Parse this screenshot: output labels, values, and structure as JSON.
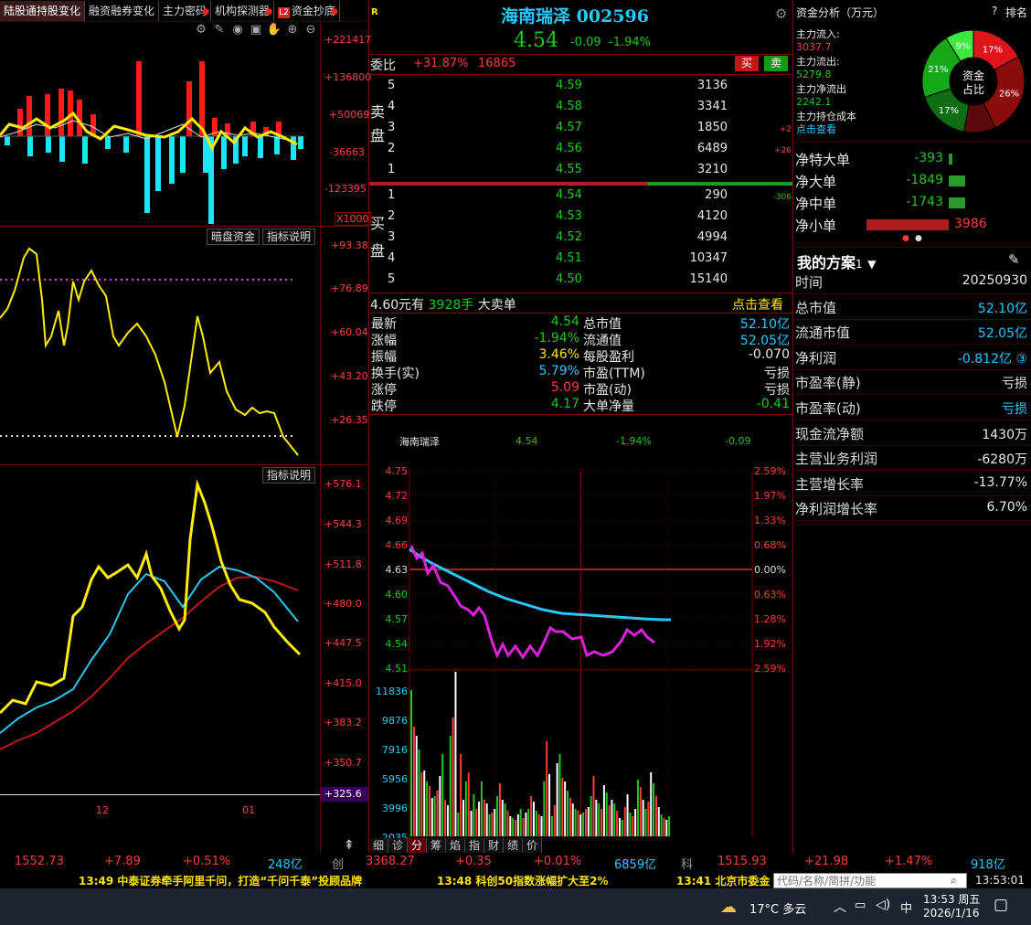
{
  "tabs": [
    {
      "label": "陆股通持股变化",
      "active": true,
      "dot": false
    },
    {
      "label": "融资融券变化",
      "active": false,
      "dot": false
    },
    {
      "label": "主力密码",
      "active": false,
      "dot": true
    },
    {
      "label": "机构探测器",
      "active": false,
      "dot": true
    },
    {
      "label": "资金抄底",
      "active": false,
      "dot": true,
      "badge": "L2"
    }
  ],
  "panel1": {
    "axis": [
      "+221417",
      "+136800",
      "+50069",
      "-36663",
      "-123395"
    ],
    "unit": "X1000"
  },
  "panel2": {
    "buttons": [
      "暗盘资金",
      "指标说明"
    ],
    "axis": [
      "+93.38",
      "+76.89",
      "+60.04",
      "+43.20",
      "+26.35"
    ]
  },
  "panel3": {
    "button": "指标说明",
    "axis": [
      "+576.1",
      "+544.3",
      "+511.8",
      "+480.0",
      "+447.5",
      "+415.0",
      "+383.2",
      "+350.7"
    ],
    "current": "+325.6",
    "xlabels": [
      "12",
      "01"
    ]
  },
  "header": {
    "r_badge": "R",
    "name": "海南瑞泽",
    "code": "002596",
    "price": "4.54",
    "change": "-0.09",
    "pct": "-1.94%"
  },
  "weibi": {
    "label": "委比",
    "pct": "+31.87%",
    "diff": "16865",
    "buy": "买",
    "sell": "卖"
  },
  "orderbook": {
    "sell_label": [
      "卖",
      "盘"
    ],
    "buy_label": [
      "买",
      "盘"
    ],
    "asks": [
      {
        "lvl": "5",
        "price": "4.59",
        "vol": "3136",
        "chg": ""
      },
      {
        "lvl": "4",
        "price": "4.58",
        "vol": "3341",
        "chg": ""
      },
      {
        "lvl": "3",
        "price": "4.57",
        "vol": "1850",
        "chg": "+2"
      },
      {
        "lvl": "2",
        "price": "4.56",
        "vol": "6489",
        "chg": "+26"
      },
      {
        "lvl": "1",
        "price": "4.55",
        "vol": "3210",
        "chg": ""
      }
    ],
    "bids": [
      {
        "lvl": "1",
        "price": "4.54",
        "vol": "290",
        "chg": "-306"
      },
      {
        "lvl": "2",
        "price": "4.53",
        "vol": "4120",
        "chg": ""
      },
      {
        "lvl": "3",
        "price": "4.52",
        "vol": "4994",
        "chg": ""
      },
      {
        "lvl": "4",
        "price": "4.51",
        "vol": "10347",
        "chg": ""
      },
      {
        "lvl": "5",
        "price": "4.50",
        "vol": "15140",
        "chg": ""
      }
    ]
  },
  "bigorder": {
    "price": "4.60元有",
    "vol": "3928手",
    "label": "大卖单",
    "link": "点击查看"
  },
  "stats": {
    "left": [
      {
        "k": "最新",
        "v": "4.54",
        "c": "grn"
      },
      {
        "k": "涨幅",
        "v": "-1.94%",
        "c": "grn"
      },
      {
        "k": "振幅",
        "v": "3.46%",
        "c": "yel"
      },
      {
        "k": "换手(实)",
        "v": "5.79%",
        "c": "cyn"
      },
      {
        "k": "涨停",
        "v": "5.09",
        "c": "red"
      },
      {
        "k": "跌停",
        "v": "4.17",
        "c": "grn"
      }
    ],
    "right": [
      {
        "k": "总市值",
        "v": "52.10亿",
        "c": "cyn"
      },
      {
        "k": "流通值",
        "v": "52.05亿",
        "c": "cyn"
      },
      {
        "k": "每股盈利",
        "v": "-0.070",
        "c": "wht"
      },
      {
        "k": "市盈(TTM)",
        "v": "亏损",
        "c": "wht"
      },
      {
        "k": "市盈(动)",
        "v": "亏损",
        "c": "wht"
      },
      {
        "k": "大单净量",
        "v": "-0.41",
        "c": "grn"
      }
    ]
  },
  "intraday": {
    "title": "海南瑞泽",
    "price": "4.54",
    "pct": "-1.94%",
    "chg": "-0.09",
    "yticks": [
      "4.75",
      "4.72",
      "4.69",
      "4.66",
      "4.63",
      "4.60",
      "4.57",
      "4.54",
      "4.51"
    ],
    "pticks": [
      "2.59%",
      "1.97%",
      "1.33%",
      "0.68%",
      "0.00%",
      "0.63%",
      "1.28%",
      "1.92%",
      "2.59%"
    ],
    "volticks": [
      "11836",
      "9876",
      "7916",
      "5956",
      "3996",
      "2035"
    ],
    "tabs": [
      "细",
      "诊",
      "分",
      "筹",
      "焰",
      "指",
      "财",
      "绩",
      "价"
    ],
    "active_tab": "分"
  },
  "capital": {
    "title": "资金分析（万元）",
    "help": "?",
    "rank": "排名",
    "inflow_label": "主力流入:",
    "inflow": "3037.7",
    "outflow_label": "主力流出:",
    "outflow": "5279.8",
    "net_label": "主力净流出",
    "net": "2242.1",
    "cost_label": "主力持仓成本",
    "cost_link": "点击查看",
    "donut_center": [
      "资金",
      "占比"
    ],
    "donut": [
      {
        "label": "17%",
        "value": 17,
        "color": "#e0151c"
      },
      {
        "label": "26%",
        "value": 26,
        "color": "#8a0d0d"
      },
      {
        "label": "",
        "value": 10,
        "color": "#5a0a0a"
      },
      {
        "label": "17%",
        "value": 17,
        "color": "#0f6e12"
      },
      {
        "label": "21%",
        "value": 21,
        "color": "#17a81a"
      },
      {
        "label": "9%",
        "value": 9,
        "color": "#3ee83e"
      }
    ]
  },
  "netflow": [
    {
      "label": "净特大单",
      "value": "-393",
      "c": "grn",
      "frac": 0.1
    },
    {
      "label": "净大单",
      "value": "-1849",
      "c": "grn",
      "frac": 0.46
    },
    {
      "label": "净中单",
      "value": "-1743",
      "c": "grn",
      "frac": 0.44
    },
    {
      "label": "净小单",
      "value": "3986",
      "c": "red",
      "frac": 1.0
    }
  ],
  "plan": {
    "title": "我的方案",
    "num": "1",
    "edit": "✎",
    "rows": [
      {
        "k": "时间",
        "v": "20250930",
        "c": "wht"
      },
      {
        "k": "总市值",
        "v": "52.10亿",
        "c": "cyn"
      },
      {
        "k": "流通市值",
        "v": "52.05亿",
        "c": "cyn"
      },
      {
        "k": "净利润",
        "v": "-0.812亿 ③",
        "c": "cyn"
      },
      {
        "k": "市盈率(静)",
        "v": "亏损",
        "c": "wht"
      },
      {
        "k": "市盈率(动)",
        "v": "亏损",
        "c": "cyn"
      },
      {
        "k": "现金流净额",
        "v": "1430万",
        "c": "wht"
      },
      {
        "k": "主营业务利润",
        "v": "-6280万",
        "c": "wht"
      },
      {
        "k": "主营增长率",
        "v": "-13.77%",
        "c": "wht"
      },
      {
        "k": "净利润增长率",
        "v": "6.70%",
        "c": "wht"
      }
    ]
  },
  "status": {
    "sh": {
      "val": "1552.73",
      "chg": "+7.89",
      "pct": "+0.51%",
      "amt": "248亿"
    },
    "cy": {
      "label": "创",
      "val": "3368.27",
      "chg": "+0.35",
      "pct": "+0.01%",
      "amt": "6859亿"
    },
    "kc": {
      "label": "科",
      "val": "1515.93",
      "chg": "+21.98",
      "pct": "+1.47%",
      "amt": "918亿"
    }
  },
  "news": [
    {
      "time": "13:49",
      "text": "中泰证券牵手阿里千问，打造“千问千泰”投顾品牌"
    },
    {
      "time": "13:48",
      "text": "科创50指数涨幅扩大至2%"
    },
    {
      "time": "13:41",
      "text": "北京市委金"
    }
  ],
  "search": {
    "placeholder": "代码/名称/简拼/功能",
    "clock": "13:53:01"
  },
  "taskbar": {
    "weather": "17°C 多云",
    "ime": "中",
    "time": "13:53 周五",
    "date": "2026/1/16"
  }
}
